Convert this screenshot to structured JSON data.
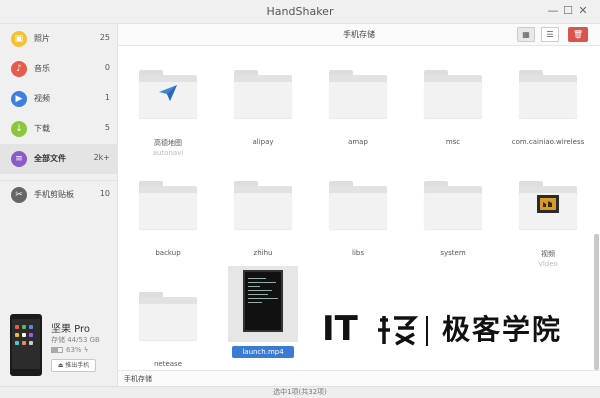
{
  "window": {
    "title": "HandShaker"
  },
  "sidebar": {
    "items": [
      {
        "label": "照片",
        "count": "25",
        "icon": "photo-icon",
        "color": "#f5c033"
      },
      {
        "label": "音乐",
        "count": "0",
        "icon": "music-icon",
        "color": "#e55b4d"
      },
      {
        "label": "视频",
        "count": "1",
        "icon": "video-icon",
        "color": "#3e7fe0"
      },
      {
        "label": "下载",
        "count": "5",
        "icon": "download-icon",
        "color": "#8cc63f"
      },
      {
        "label": "全部文件",
        "count": "2k+",
        "icon": "files-icon",
        "color": "#8a5cc9"
      },
      {
        "label": "手机剪贴板",
        "count": "10",
        "icon": "clipboard-icon",
        "color": "#666666"
      }
    ]
  },
  "device": {
    "name": "坚果 Pro",
    "storage": "存储 44/53 GB",
    "battery": "63%",
    "battery_level": 0.63,
    "eject_label": "推出手机"
  },
  "toolbar": {
    "path": "手机存储",
    "grid_icon": "grid-view-icon",
    "list_icon": "list-view-icon",
    "delete_icon": "trash-icon"
  },
  "files": [
    {
      "name": "高德地图",
      "sub": "autonavi",
      "type": "folder-app"
    },
    {
      "name": "alipay",
      "type": "folder"
    },
    {
      "name": "amap",
      "type": "folder"
    },
    {
      "name": "msc",
      "type": "folder"
    },
    {
      "name": "com.cainiao.wireless",
      "type": "folder"
    },
    {
      "name": "backup",
      "type": "folder"
    },
    {
      "name": "zhihu",
      "type": "folder"
    },
    {
      "name": "libs",
      "type": "folder"
    },
    {
      "name": "system",
      "type": "folder"
    },
    {
      "name": "视频",
      "sub": "Video",
      "type": "folder-video"
    },
    {
      "name": "netease",
      "type": "folder"
    },
    {
      "name": "launch.mp4",
      "type": "video",
      "selected": true
    }
  ],
  "bottom_path": "手机存储",
  "status": "选中1项(共32项)",
  "watermark": {
    "latin": "IT",
    "cn": "极客学院"
  }
}
